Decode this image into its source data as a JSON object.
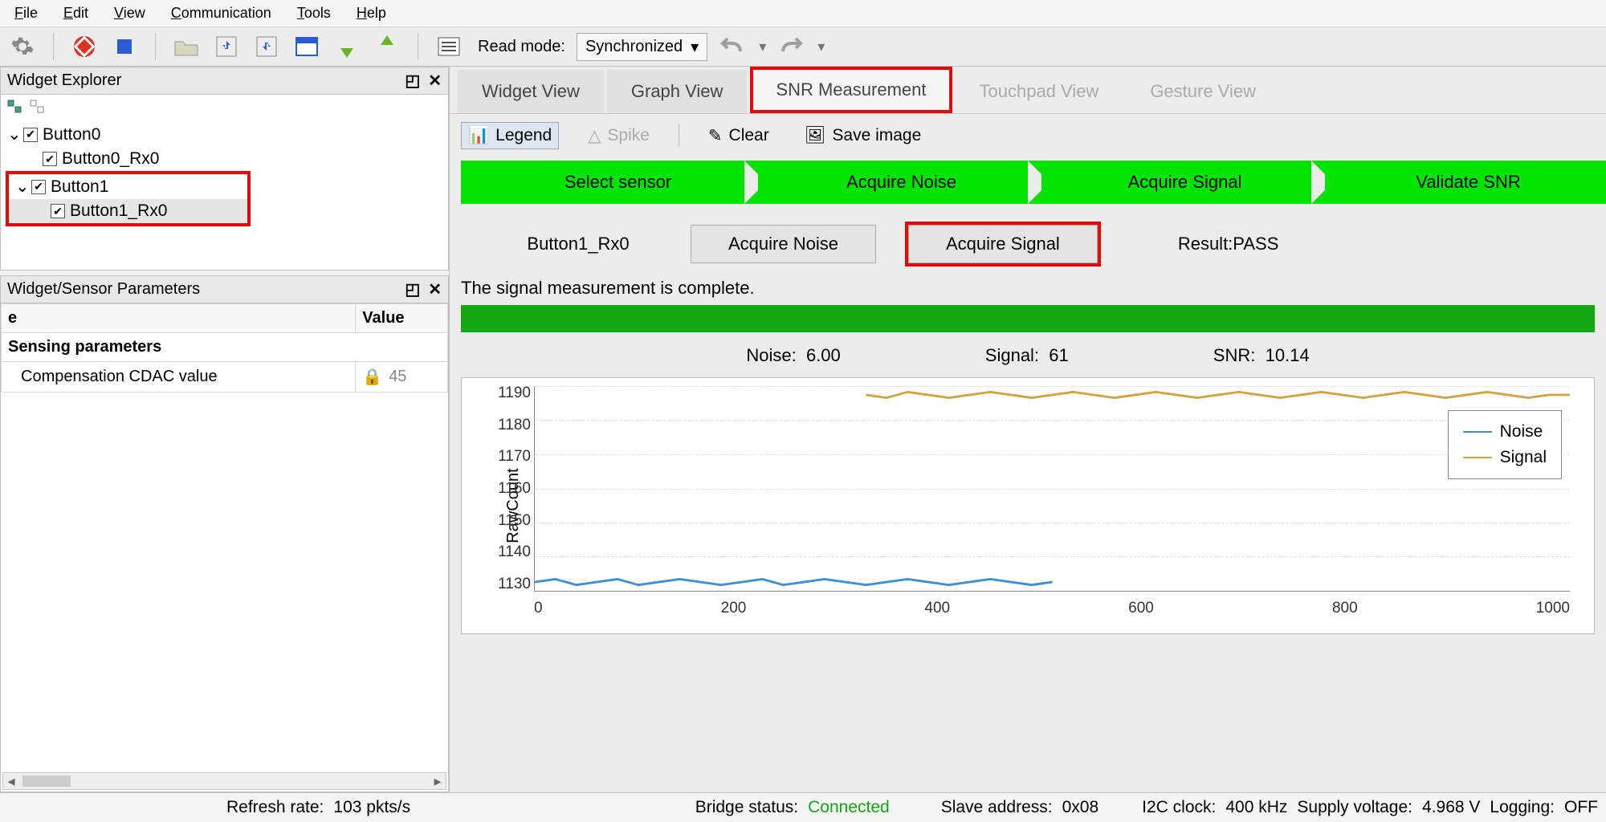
{
  "menu": {
    "file": "File",
    "edit": "Edit",
    "view": "View",
    "communication": "Communication",
    "tools": "Tools",
    "help": "Help"
  },
  "toolbar": {
    "read_mode_label": "Read mode:",
    "read_mode_value": "Synchronized"
  },
  "panels": {
    "explorer": {
      "title": "Widget Explorer",
      "items": [
        {
          "label": "Button0",
          "children": [
            {
              "label": "Button0_Rx0"
            }
          ]
        },
        {
          "label": "Button1",
          "children": [
            {
              "label": "Button1_Rx0"
            }
          ]
        }
      ]
    },
    "params": {
      "title": "Widget/Sensor Parameters",
      "col_name": "e",
      "col_value": "Value",
      "section": "Sensing parameters",
      "row_name": "Compensation CDAC value",
      "row_value": "45"
    }
  },
  "tabs": {
    "widget": "Widget View",
    "graph": "Graph View",
    "snr": "SNR Measurement",
    "touchpad": "Touchpad View",
    "gesture": "Gesture View"
  },
  "subtoolbar": {
    "legend": "Legend",
    "spike": "Spike",
    "clear": "Clear",
    "save": "Save image"
  },
  "steps": {
    "s1": "Select sensor",
    "s2": "Acquire Noise",
    "s3": "Acquire Signal",
    "s4": "Validate SNR"
  },
  "actions": {
    "sensor": "Button1_Rx0",
    "noise_btn": "Acquire Noise",
    "signal_btn": "Acquire Signal",
    "result": "Result:PASS"
  },
  "message": "The signal measurement is complete.",
  "metrics": {
    "noise_label": "Noise:",
    "noise": "6.00",
    "signal_label": "Signal:",
    "signal": "61",
    "snr_label": "SNR:",
    "snr": "10.14"
  },
  "chart": {
    "ylabel": "RawCount",
    "legend_noise": "Noise",
    "legend_signal": "Signal"
  },
  "chart_data": {
    "type": "line",
    "xlabel": "",
    "ylabel": "RawCount",
    "xlim": [
      0,
      1000
    ],
    "ylim": [
      1128,
      1195
    ],
    "x_ticks": [
      "0",
      "200",
      "400",
      "600",
      "800",
      "1000"
    ],
    "y_ticks": [
      "1190",
      "1180",
      "1170",
      "1160",
      "1150",
      "1140",
      "1130"
    ],
    "series": [
      {
        "name": "Noise",
        "color": "#3b8fd6",
        "approx_level": 1131,
        "x_range": [
          0,
          500
        ]
      },
      {
        "name": "Signal",
        "color": "#d6a23b",
        "approx_level": 1192,
        "x_range": [
          320,
          1000
        ]
      }
    ],
    "noise_value": 6.0,
    "signal_value": 61,
    "snr": 10.14
  },
  "status": {
    "refresh_label": "Refresh rate:",
    "refresh": "103 pkts/s",
    "bridge_label": "Bridge status:",
    "bridge": "Connected",
    "slave_label": "Slave address:",
    "slave": "0x08",
    "i2c_label": "I2C clock:",
    "i2c": "400 kHz",
    "supply_label": "Supply voltage:",
    "supply": "4.968 V",
    "log_label": "Logging:",
    "log": "OFF"
  }
}
